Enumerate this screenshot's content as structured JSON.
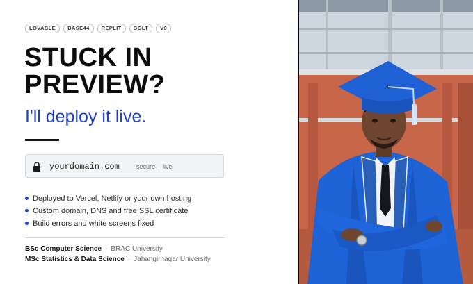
{
  "tags": [
    "LOVABLE",
    "BASE44",
    "REPLIT",
    "BOLT",
    "V0"
  ],
  "headline": "STUCK IN\nPREVIEW?",
  "subheadline": "I'll deploy it live.",
  "domain_box": {
    "domain": "yourdomain.com",
    "status_left": "secure",
    "status_sep": "·",
    "status_right": "live"
  },
  "features": [
    "Deployed to Vercel, Netlify or your own hosting",
    "Custom domain, DNS and free SSL certificate",
    "Build errors and white screens fixed"
  ],
  "education": [
    {
      "degree": "BSc Computer Science",
      "sep": "·",
      "university": "BRAC University"
    },
    {
      "degree": "MSc Statistics & Data Science",
      "sep": "·",
      "university": "Jahangirnagar University"
    }
  ],
  "colors": {
    "accent": "#1f42c8",
    "gown": "#1e63d6",
    "building": "#c8664a"
  }
}
